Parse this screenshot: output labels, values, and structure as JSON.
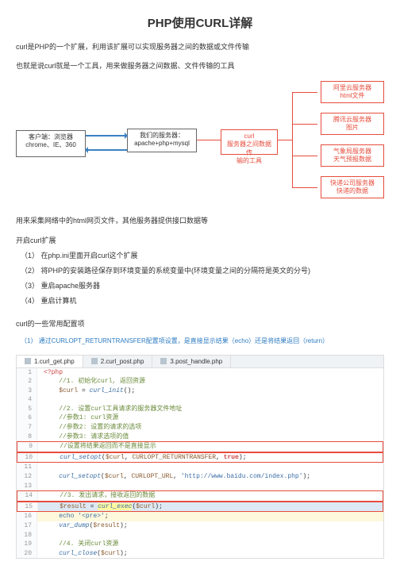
{
  "title": "PHP使用CURL详解",
  "intro1": "curl是PHP的一个扩展，利用该扩展可以实现服务器之间的数据或文件传输",
  "intro2": "也就是说curl就是一个工具，用来做服务器之间数据、文件传输的工具",
  "diagram": {
    "client": {
      "l1": "客户端：浏览器",
      "l2": "chrome、IE、360"
    },
    "server": {
      "l1": "我们的服务器：",
      "l2": "apache+php+mysql"
    },
    "curlbox": {
      "l1": "curl",
      "l2": "服务器之间数据传",
      "l3": "输的工具"
    },
    "svc1": {
      "l1": "阿里云服务器",
      "l2": "html文件"
    },
    "svc2": {
      "l1": "腾讯云服务器",
      "l2": "图片"
    },
    "svc3": {
      "l1": "气象局服务器",
      "l2": "天气预报数据"
    },
    "svc4": {
      "l1": "快递公司服务器",
      "l2": "快递的数据"
    }
  },
  "para3": "用来采集网络中的html网页文件，其他服务器提供接口数据等",
  "para4": "开启curl扩展",
  "steps": {
    "s1": "（1）  在php.ini里面开启curl这个扩展",
    "s2": "（2）  将PHP的安装路径保存到环境变量的系统变量中(环境变量之间的分隔符是英文的分号)",
    "s3": "（3）  重启apache服务器",
    "s4": "（4）  重启计算机"
  },
  "conf": "curl的一些常用配置项",
  "conf1": "（1）  通过CURLOPT_RETURNTRANSFER配置项设置，是直接显示结果（echo）还是将结果返回（return）",
  "tabs": {
    "t1": "1.curl_get.php",
    "t2": "2.curl_post.php",
    "t3": "3.post_handle.php"
  },
  "code": {
    "l1": "<?php",
    "l2": "    //1. 初始化curl, 返回资源",
    "l3": "    $curl = curl_init();",
    "l4": "",
    "l5": "    //2. 设置curl工具请求的服务器文件地址",
    "l6": "    //参数1: curl资源",
    "l7": "    //参数2: 设置的请求的选项",
    "l8": "    //参数3: 请求选项的值",
    "l9": "    //设置将结果返回而不是直接显示",
    "l10": "    curl_setopt($curl, CURLOPT_RETURNTRANSFER, true);",
    "l11": "",
    "l12": "    curl_setopt($curl, CURLOPT_URL, 'http://www.baidu.com/index.php');",
    "l13": "",
    "l14": "    //3. 发出请求，接收返回的数据",
    "l15": "    $result = curl_exec($curl);",
    "l16": "    echo '<pre>';",
    "l17": "    var_dump($result);",
    "l18": "",
    "l19": "    //4. 关闭curl资源",
    "l20": "    curl_close($curl);"
  }
}
